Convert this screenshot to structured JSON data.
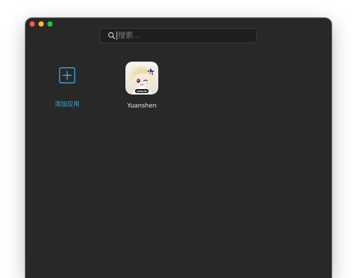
{
  "window": {
    "controls": [
      "close",
      "minimize",
      "maximize"
    ]
  },
  "search": {
    "placeholder": "搜索...",
    "value": "",
    "icon": "search-icon"
  },
  "apps": {
    "add": {
      "label": "添加应用",
      "icon": "plus-square-icon",
      "color": "#3fa9e0"
    },
    "items": [
      {
        "label": "Yuanshen",
        "icon": "yuanshen-app-icon",
        "badge": "miHoYo"
      }
    ]
  },
  "theme": {
    "window_bg": "#282828",
    "accent": "#3fa9e0"
  }
}
